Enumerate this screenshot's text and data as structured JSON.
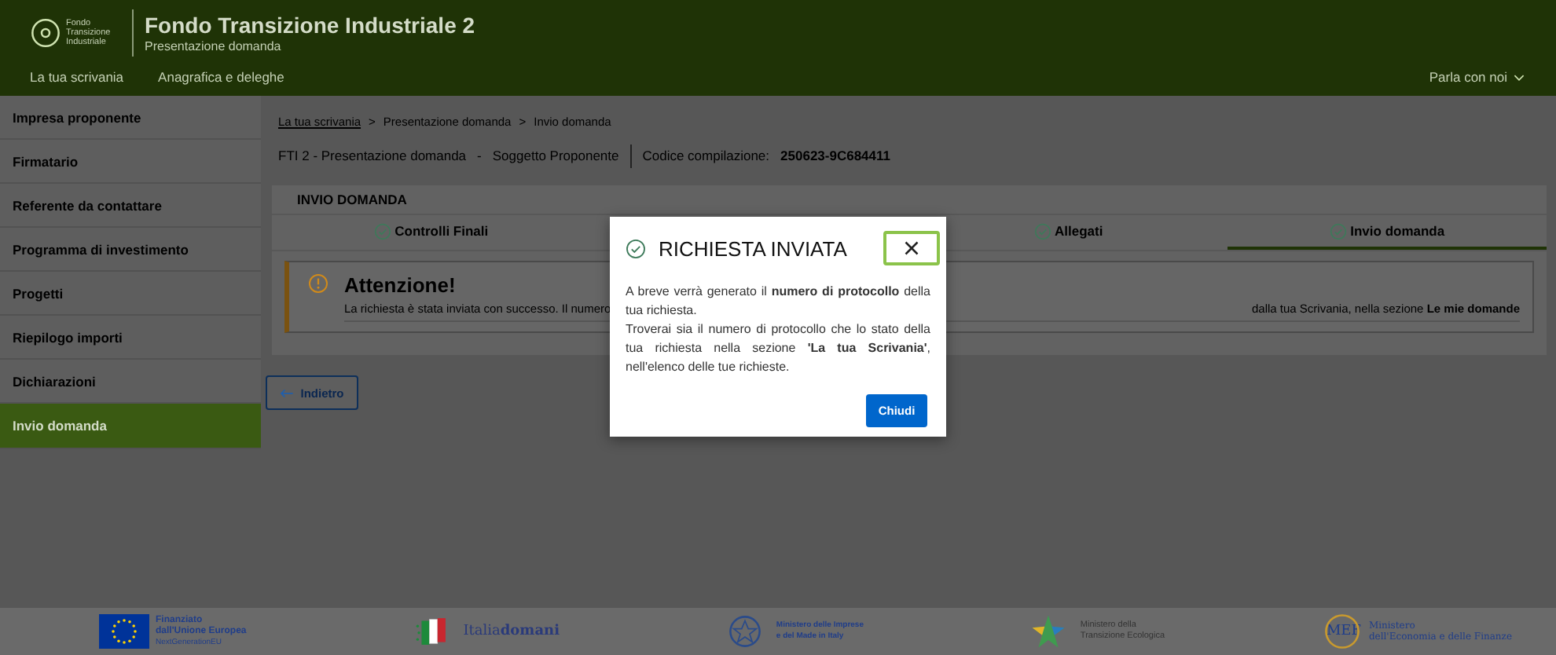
{
  "header": {
    "logo_text": "Fondo Transizione Industriale",
    "title": "Fondo Transizione Industriale 2",
    "subtitle": "Presentazione domanda",
    "nav": [
      "La tua scrivania",
      "Anagrafica e deleghe"
    ],
    "contact": "Parla con noi"
  },
  "sidebar": {
    "items": [
      {
        "label": "Impresa proponente",
        "selected": false
      },
      {
        "label": "Firmatario",
        "selected": false
      },
      {
        "label": "Referente da contattare",
        "selected": false
      },
      {
        "label": "Programma di investimento",
        "selected": false
      },
      {
        "label": "Progetti",
        "selected": false
      },
      {
        "label": "Riepilogo importi",
        "selected": false
      },
      {
        "label": "Dichiarazioni",
        "selected": false
      },
      {
        "label": "Invio domanda",
        "selected": true
      }
    ]
  },
  "breadcrumb": [
    {
      "kind": "link",
      "text": "La tua scrivania"
    },
    {
      "kind": "separator",
      "text": ">"
    },
    {
      "kind": "crumb",
      "text": "Presentazione domanda"
    },
    {
      "kind": "separator",
      "text": ">"
    },
    {
      "kind": "crumb",
      "text": "Invio domanda"
    }
  ],
  "context": {
    "application": "FTI 2 - Presentazione domanda",
    "separator": "-",
    "section": "Soggetto Proponente",
    "code_label": "Codice compilazione:",
    "code": "250623-9C684411"
  },
  "card": {
    "title": "INVIO DOMANDA",
    "tabs": [
      {
        "label": "Controlli Finali",
        "selected": false
      },
      {
        "label": "Allegati",
        "selected": false
      },
      {
        "label": "Invio domanda",
        "selected": true
      }
    ],
    "alert": {
      "title": "Attenzione!",
      "message_start": "La richiesta è stata inviata con successo. Il numero",
      "message_end": "dalla tua Scrivania, nella sezione **Le mie domande**"
    }
  },
  "back_button": "Indietro",
  "footer": {
    "eu": {
      "line1": "Finanziato",
      "line2": "dall'Unione Europea",
      "line3": "NextGenerationEU"
    },
    "italiadomani": {
      "prefix": "Italia",
      "suffix": "domani"
    },
    "mimit": {
      "line1": "Ministero delle Imprese",
      "line2": "e del Made in Italy"
    },
    "mite": {
      "line1": "Ministero della",
      "line2": "Transizione Ecologica"
    },
    "mef": {
      "mark": "MEF",
      "line1": "Ministero",
      "line2": "dell'Economia e delle Finanze"
    }
  },
  "modal": {
    "title": "RICHIESTA INVIATA",
    "paragraphs": [
      "A breve verrà generato il **numero di protocollo** della tua richiesta.",
      "Troverai sia il numero di protocollo che lo stato della tua richiesta nella sezione **'La tua Scrivania'**, nell'elenco delle tue richieste."
    ],
    "button": "Chiudi"
  }
}
